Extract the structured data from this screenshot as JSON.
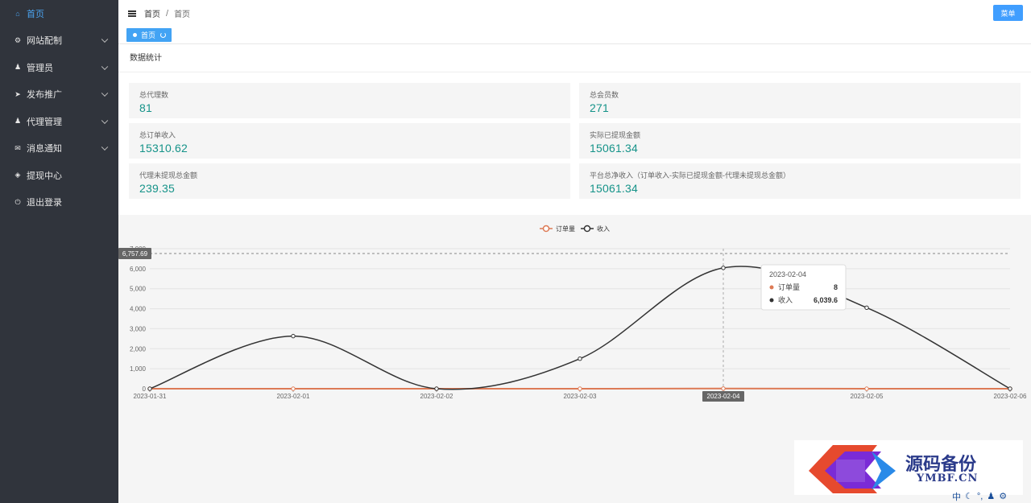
{
  "sidebar": {
    "items": [
      {
        "label": "首页",
        "icon": "home-icon",
        "active": true,
        "has_children": false
      },
      {
        "label": "网站配制",
        "icon": "gear-icon",
        "active": false,
        "has_children": true
      },
      {
        "label": "管理员",
        "icon": "user-icon",
        "active": false,
        "has_children": true
      },
      {
        "label": "发布推广",
        "icon": "send-icon",
        "active": false,
        "has_children": true
      },
      {
        "label": "代理管理",
        "icon": "user-icon",
        "active": false,
        "has_children": true
      },
      {
        "label": "消息通知",
        "icon": "mail-icon",
        "active": false,
        "has_children": true
      },
      {
        "label": "提现中心",
        "icon": "box-icon",
        "active": false,
        "has_children": false
      },
      {
        "label": "退出登录",
        "icon": "power-icon",
        "active": false,
        "has_children": false
      }
    ]
  },
  "header": {
    "breadcrumb": [
      "首页",
      "首页"
    ],
    "menu_label": "菜单"
  },
  "tabs": [
    {
      "label": "首页",
      "active": true
    }
  ],
  "stats": {
    "title": "数据统计",
    "items": [
      {
        "label": "总代理数",
        "value": "81"
      },
      {
        "label": "总会员数",
        "value": "271"
      },
      {
        "label": "总订单收入",
        "value": "15310.62"
      },
      {
        "label": "实际已提现金额",
        "value": "15061.34"
      },
      {
        "label": "代理未提现总金额",
        "value": "239.35"
      },
      {
        "label": "平台总净收入（订单收入-实际已提现金额-代理未提现总金额）",
        "value": "15061.34"
      }
    ]
  },
  "chart_data": {
    "type": "line",
    "x": [
      "2023-01-31",
      "2023-02-01",
      "2023-02-02",
      "2023-02-03",
      "2023-02-04",
      "2023-02-05",
      "2023-02-06"
    ],
    "series": [
      {
        "name": "订单量",
        "values": [
          0,
          0,
          0,
          0,
          8,
          0,
          0
        ],
        "color": "#dd7a55"
      },
      {
        "name": "收入",
        "values": [
          0,
          2630,
          0,
          1500,
          6039.6,
          4050,
          0
        ],
        "color": "#333333"
      }
    ],
    "ylim": [
      0,
      7000
    ],
    "yticks": [
      "0",
      "1,000",
      "2,000",
      "3,000",
      "4,000",
      "5,000",
      "6,000",
      "7,000"
    ],
    "legend_position": "top-center",
    "smooth": true,
    "crosshair": {
      "y_label": "6,757.69",
      "y_value": 6757.69,
      "x_label": "2023-02-04"
    },
    "tooltip": {
      "title": "2023-02-04",
      "rows": [
        {
          "name": "订单量",
          "value": "8",
          "color": "#dd7a55"
        },
        {
          "name": "收入",
          "value": "6,039.6",
          "color": "#333333"
        }
      ]
    }
  },
  "watermark": {
    "title": "源码备份",
    "subtitle": "YMBF.CN"
  }
}
